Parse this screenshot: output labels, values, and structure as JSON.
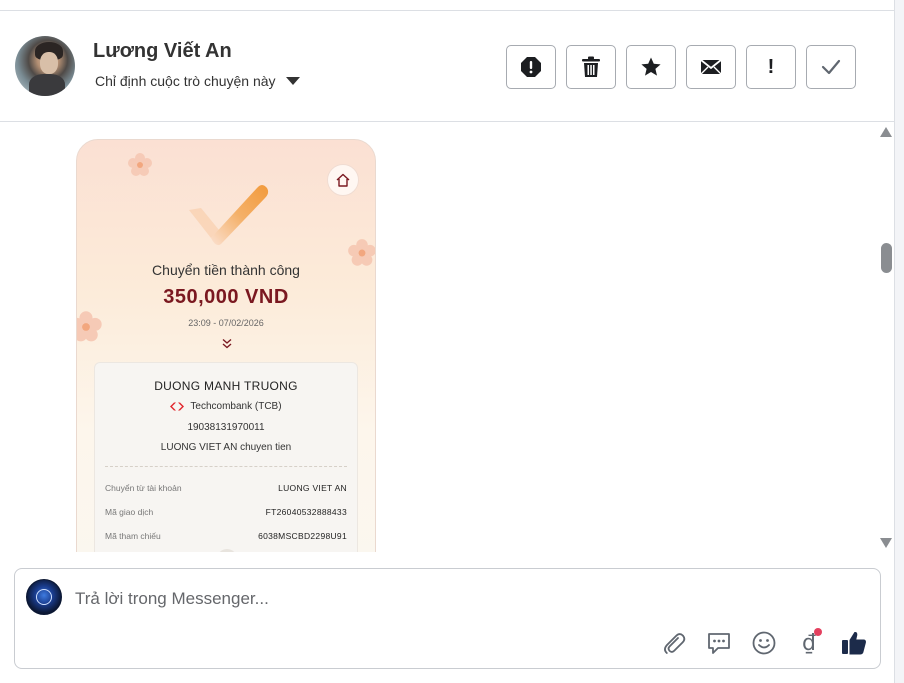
{
  "header": {
    "contact_name": "Lương Viết An",
    "assign_label": "Chỉ định cuộc trò chuyện này"
  },
  "actions": [
    {
      "icon": "alert-circle-icon"
    },
    {
      "icon": "trash-icon"
    },
    {
      "icon": "star-icon"
    },
    {
      "icon": "envelope-icon"
    },
    {
      "icon": "exclamation-icon",
      "glyph": "!"
    },
    {
      "icon": "checkmark-icon"
    }
  ],
  "receipt": {
    "title": "Chuyển tiền thành công",
    "amount": "350,000 VND",
    "datetime": "23:09 - 07/02/2026",
    "chevron": "»",
    "recipient_name": "DUONG MANH TRUONG",
    "bank": "Techcombank (TCB)",
    "account_number": "19038131970011",
    "memo": "LUONG VIET AN chuyen tien",
    "rows": [
      {
        "label": "Chuyển từ tài khoản",
        "value": "LUONG VIET AN"
      },
      {
        "label": "Mã giao dịch",
        "value": "FT26040532888433"
      },
      {
        "label": "Mã tham chiếu",
        "value": "6038MSCBD2298U91"
      }
    ],
    "colors": {
      "amount": "#7a1820",
      "accent": "#f2a04b",
      "bank_logo": "#e1262d"
    }
  },
  "composer": {
    "placeholder": "Trả lời trong Messenger...",
    "tools": [
      "paperclip-icon",
      "chat-bubble-icon",
      "smiley-icon",
      "dong-payment-icon",
      "thumbs-up-icon"
    ],
    "dong_glyph": "₫"
  }
}
